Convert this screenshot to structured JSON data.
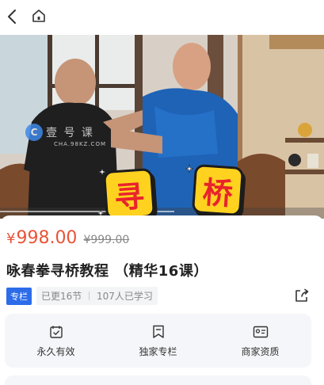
{
  "nav": {
    "back_icon": "chevron-left-icon",
    "home_icon": "home-icon"
  },
  "hero": {
    "sticker_left": "寻",
    "sticker_right": "桥",
    "watermark_text": "壹 号 课",
    "watermark_sub": "CHA.98KZ.COM"
  },
  "product": {
    "price": "998.00",
    "price_symbol": "¥",
    "original_price": "¥999.00",
    "title": "咏春拳寻桥教程 （精华16课）",
    "tag": "专栏",
    "updated": "已更16节",
    "learners": "107人已学习"
  },
  "features": [
    {
      "icon": "calendar-check-icon",
      "label": "永久有效"
    },
    {
      "icon": "bookmark-icon",
      "label": "独家专栏"
    },
    {
      "icon": "id-card-icon",
      "label": "商家资质"
    }
  ],
  "colors": {
    "price": "#e95438",
    "tag": "#2c6ce9",
    "sticker_bg": "#ffd21f",
    "sticker_text": "#e8232c"
  }
}
